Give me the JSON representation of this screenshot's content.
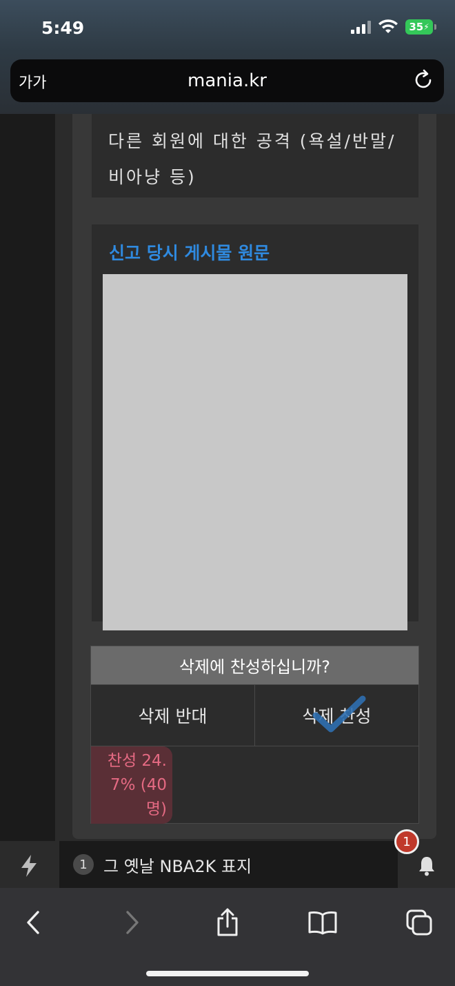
{
  "status_bar": {
    "time": "5:49",
    "battery": "35"
  },
  "browser": {
    "text_size_label": "가가",
    "url": "mania.kr"
  },
  "report": {
    "reason_text": "다른 회원에 대한 공격 (욕설/반말/비아냥 등)",
    "original_post_title": "신고 당시 게시물 원문"
  },
  "vote": {
    "question": "삭제에 찬성하십니까?",
    "oppose_label": "삭제 반대",
    "approve_label": "삭제 찬성",
    "result_text": "찬성 24.7% (40명)",
    "approve_fraction": 0.247
  },
  "notification": {
    "rank": "1",
    "headline": "그 옛날 NBA2K 표지",
    "badge_count": "1"
  },
  "colors": {
    "accent_blue": "#2f8ae0",
    "result_pink": "#e56a83",
    "badge_red": "#c0392b",
    "battery_green": "#34c759"
  }
}
